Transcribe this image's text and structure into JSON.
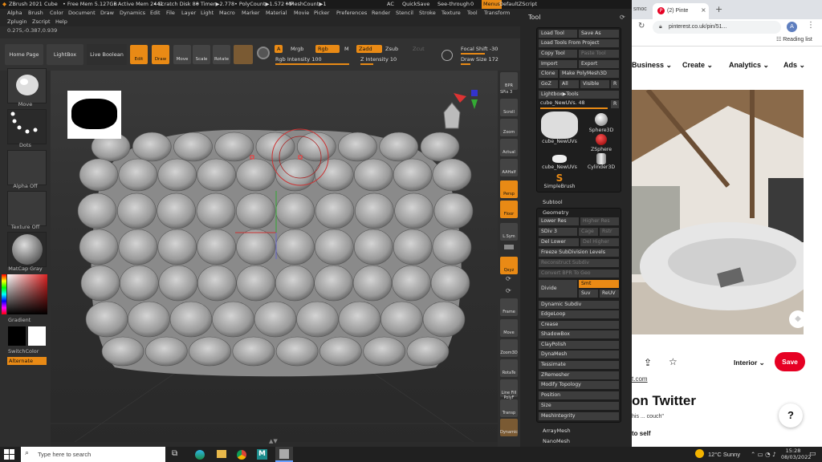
{
  "zbrush": {
    "titlebar": {
      "app": "ZBrush 2021",
      "doc": "Cube",
      "free_mem": "• Free Mem 5.127GB",
      "active_mem": "• Active Mem 2441",
      "scratch": "• Scratch Disk 80",
      "timer": "• Timer▶2.778",
      "polycount": "• PolyCount▶1.572 MP",
      "meshcount": "• MeshCount▶1",
      "ac": "AC",
      "quicksave": "QuickSave",
      "seethrough": "See-through",
      "seethrough_val": "0",
      "menus": "Menus",
      "defaultzscript": "DefaultZScript"
    },
    "menu1": [
      "Alpha",
      "Brush",
      "Color",
      "Document",
      "Draw",
      "Dynamics",
      "Edit",
      "File",
      "Layer",
      "Light",
      "Macro",
      "Marker",
      "Material",
      "Movie",
      "Picker",
      "Preferences",
      "Render",
      "Stencil",
      "Stroke",
      "Texture",
      "Tool",
      "Transform"
    ],
    "menu2": [
      "Zplugin",
      "Zscript",
      "Help"
    ],
    "coords": "0.275,-0.387,0.939",
    "shelf": {
      "home": "Home Page",
      "lightbox": "LightBox",
      "live_boolean": "Live Boolean",
      "edit": "Edit",
      "draw": "Draw",
      "move": "Move",
      "scale": "Scale",
      "rotate": "Rotate",
      "a": "A",
      "mrgb": "Mrgb",
      "rgb": "Rgb",
      "m": "M",
      "zadd": "Zadd",
      "zsub": "Zsub",
      "zcut": "Zcut",
      "rgb_intensity": "Rgb Intensity 100",
      "z_intensity": "Z Intensity 10",
      "focal_shift": "Focal Shift -30",
      "draw_size": "Draw Size 172"
    },
    "left": {
      "brush": "Move",
      "stroke": "Dots",
      "alpha": "Alpha Off",
      "texture": "Texture Off",
      "material": "MatCap Gray",
      "gradient": "Gradient",
      "switchcolor": "SwitchColor",
      "alternate": "Alternate"
    },
    "right": [
      "BPR",
      "SPix 3",
      "Scroll",
      "Zoom",
      "Actual",
      "AAHalf",
      "Persp",
      "Floor",
      "L.Sym",
      "",
      "Qxyz",
      "",
      "",
      "Frame",
      "Move",
      "Zoom3D",
      "RotaTe",
      "Line Fill PolyF",
      "Transp",
      "Dynamic"
    ],
    "tool": {
      "title": "Tool",
      "load_tool": "Load Tool",
      "save_as": "Save As",
      "load_from_project": "Load Tools From Project",
      "copy_tool": "Copy Tool",
      "paste_tool": "Paste Tool",
      "import": "Import",
      "export": "Export",
      "clone": "Clone",
      "make_polymesh": "Make PolyMesh3D",
      "goz": "GoZ",
      "all": "All",
      "visible": "Visible",
      "r": "R",
      "lightbox_tools": "Lightbox▶Tools",
      "current": "cube_NewUVs. 48",
      "r2": "R",
      "thumbs": [
        "cube_NewUVs",
        "Sphere3D",
        "ZSphere",
        "cube_NewUVs",
        "Cylinder3D",
        "SimpleBrush"
      ]
    },
    "subtool": "Subtool",
    "geometry": {
      "title": "Geometry",
      "lower_res": "Lower Res",
      "higher_res": "Higher Res",
      "sdiv": "SDiv 3",
      "cage": "Cage",
      "rstr": "Rstr",
      "del_lower": "Del Lower",
      "del_higher": "Del Higher",
      "freeze": "Freeze SubDivision Levels",
      "reconstruct": "Reconstruct Subdiv",
      "convert_bpr": "Convert BPR To Geo",
      "divide": "Divide",
      "smt": "Smt",
      "suv": "Suv",
      "reuv": "ReUV",
      "items": [
        "Dynamic Subdiv",
        "EdgeLoop",
        "Crease",
        "ShadowBox",
        "ClayPolish",
        "DynaMesh",
        "Tessimate",
        "ZRemesher",
        "Modify Topology",
        "Position",
        "Size",
        "MeshIntegrity"
      ]
    },
    "array_mesh": "ArrayMesh",
    "nano_mesh": "NanoMesh"
  },
  "browser": {
    "tab1": "smoc",
    "tab2": "(2) Pinte",
    "address": "pinterest.co.uk/pin/51...",
    "avatar": "A",
    "reading_list": "Reading list",
    "nav": [
      "Business",
      "Create",
      "Analytics",
      "Ads"
    ],
    "category": "Interior",
    "save": "Save",
    "link_frag": "t.com",
    "heading_frag": "on Twitter",
    "quote_frag": "his ... couch\"",
    "self_frag": "to self",
    "help": "?"
  },
  "taskbar": {
    "search": "Type here to search",
    "weather": "12°C  Sunny",
    "time": "15:28",
    "date": "08/03/2022"
  }
}
